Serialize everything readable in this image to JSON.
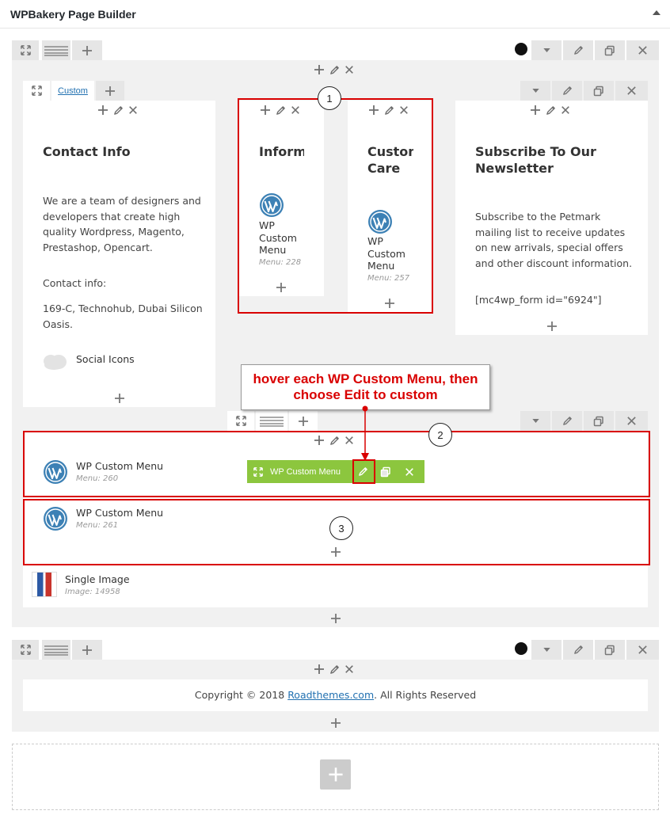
{
  "panel": {
    "title": "WPBakery Page Builder"
  },
  "row1": {
    "inner": {
      "tab_label": "Custom",
      "col1": {
        "heading": "Contact Info",
        "text": "We are a team of designers and developers that create high quality Wordpress, Magento, Prestashop, Opencart.",
        "contact_label": "Contact info:",
        "address": "169-C, Technohub, Dubai Silicon Oasis.",
        "social": "Social Icons"
      },
      "col2a": {
        "heading": "Informa",
        "el_name": "WP Custom Menu",
        "el_sub": "Menu: 228"
      },
      "col2b": {
        "heading": "Customer Care",
        "el_name": "WP Custom Menu",
        "el_sub": "Menu: 257"
      },
      "col3": {
        "heading": "Subscribe To Our Newsletter",
        "text": "Subscribe to the Petmark mailing list to receive updates on new arrivals, special offers and other discount information.",
        "shortcode": "[mc4wp_form id=\"6924\"]"
      }
    },
    "elements": [
      {
        "name": "WP Custom Menu",
        "sub": "Menu: 260"
      },
      {
        "name": "WP Custom Menu",
        "sub": "Menu: 261"
      },
      {
        "name": "Single Image",
        "sub": "Image: 14958"
      }
    ],
    "hover_bar": {
      "label": "WP Custom Menu"
    }
  },
  "row2": {
    "copyright_prefix": "Copyright © 2018 ",
    "copyright_link": "Roadthemes.com",
    "copyright_suffix": ". All Rights Reserved"
  },
  "annotations": {
    "callout_text": "hover each WP Custom Menu, then choose Edit to custom",
    "num1": "1",
    "num2": "2",
    "num3": "3"
  },
  "colors": {
    "accent_green": "#8cc63e",
    "annotation_red": "#d90000",
    "wp_blue": "#3d81b5"
  },
  "icons": [
    "expand-icon",
    "drag-handle-icon",
    "plus-icon",
    "pencil-icon",
    "close-icon",
    "clone-icon",
    "chevron-down-icon",
    "wordpress-logo-icon",
    "cloud-icon",
    "image-thumb-icon"
  ]
}
